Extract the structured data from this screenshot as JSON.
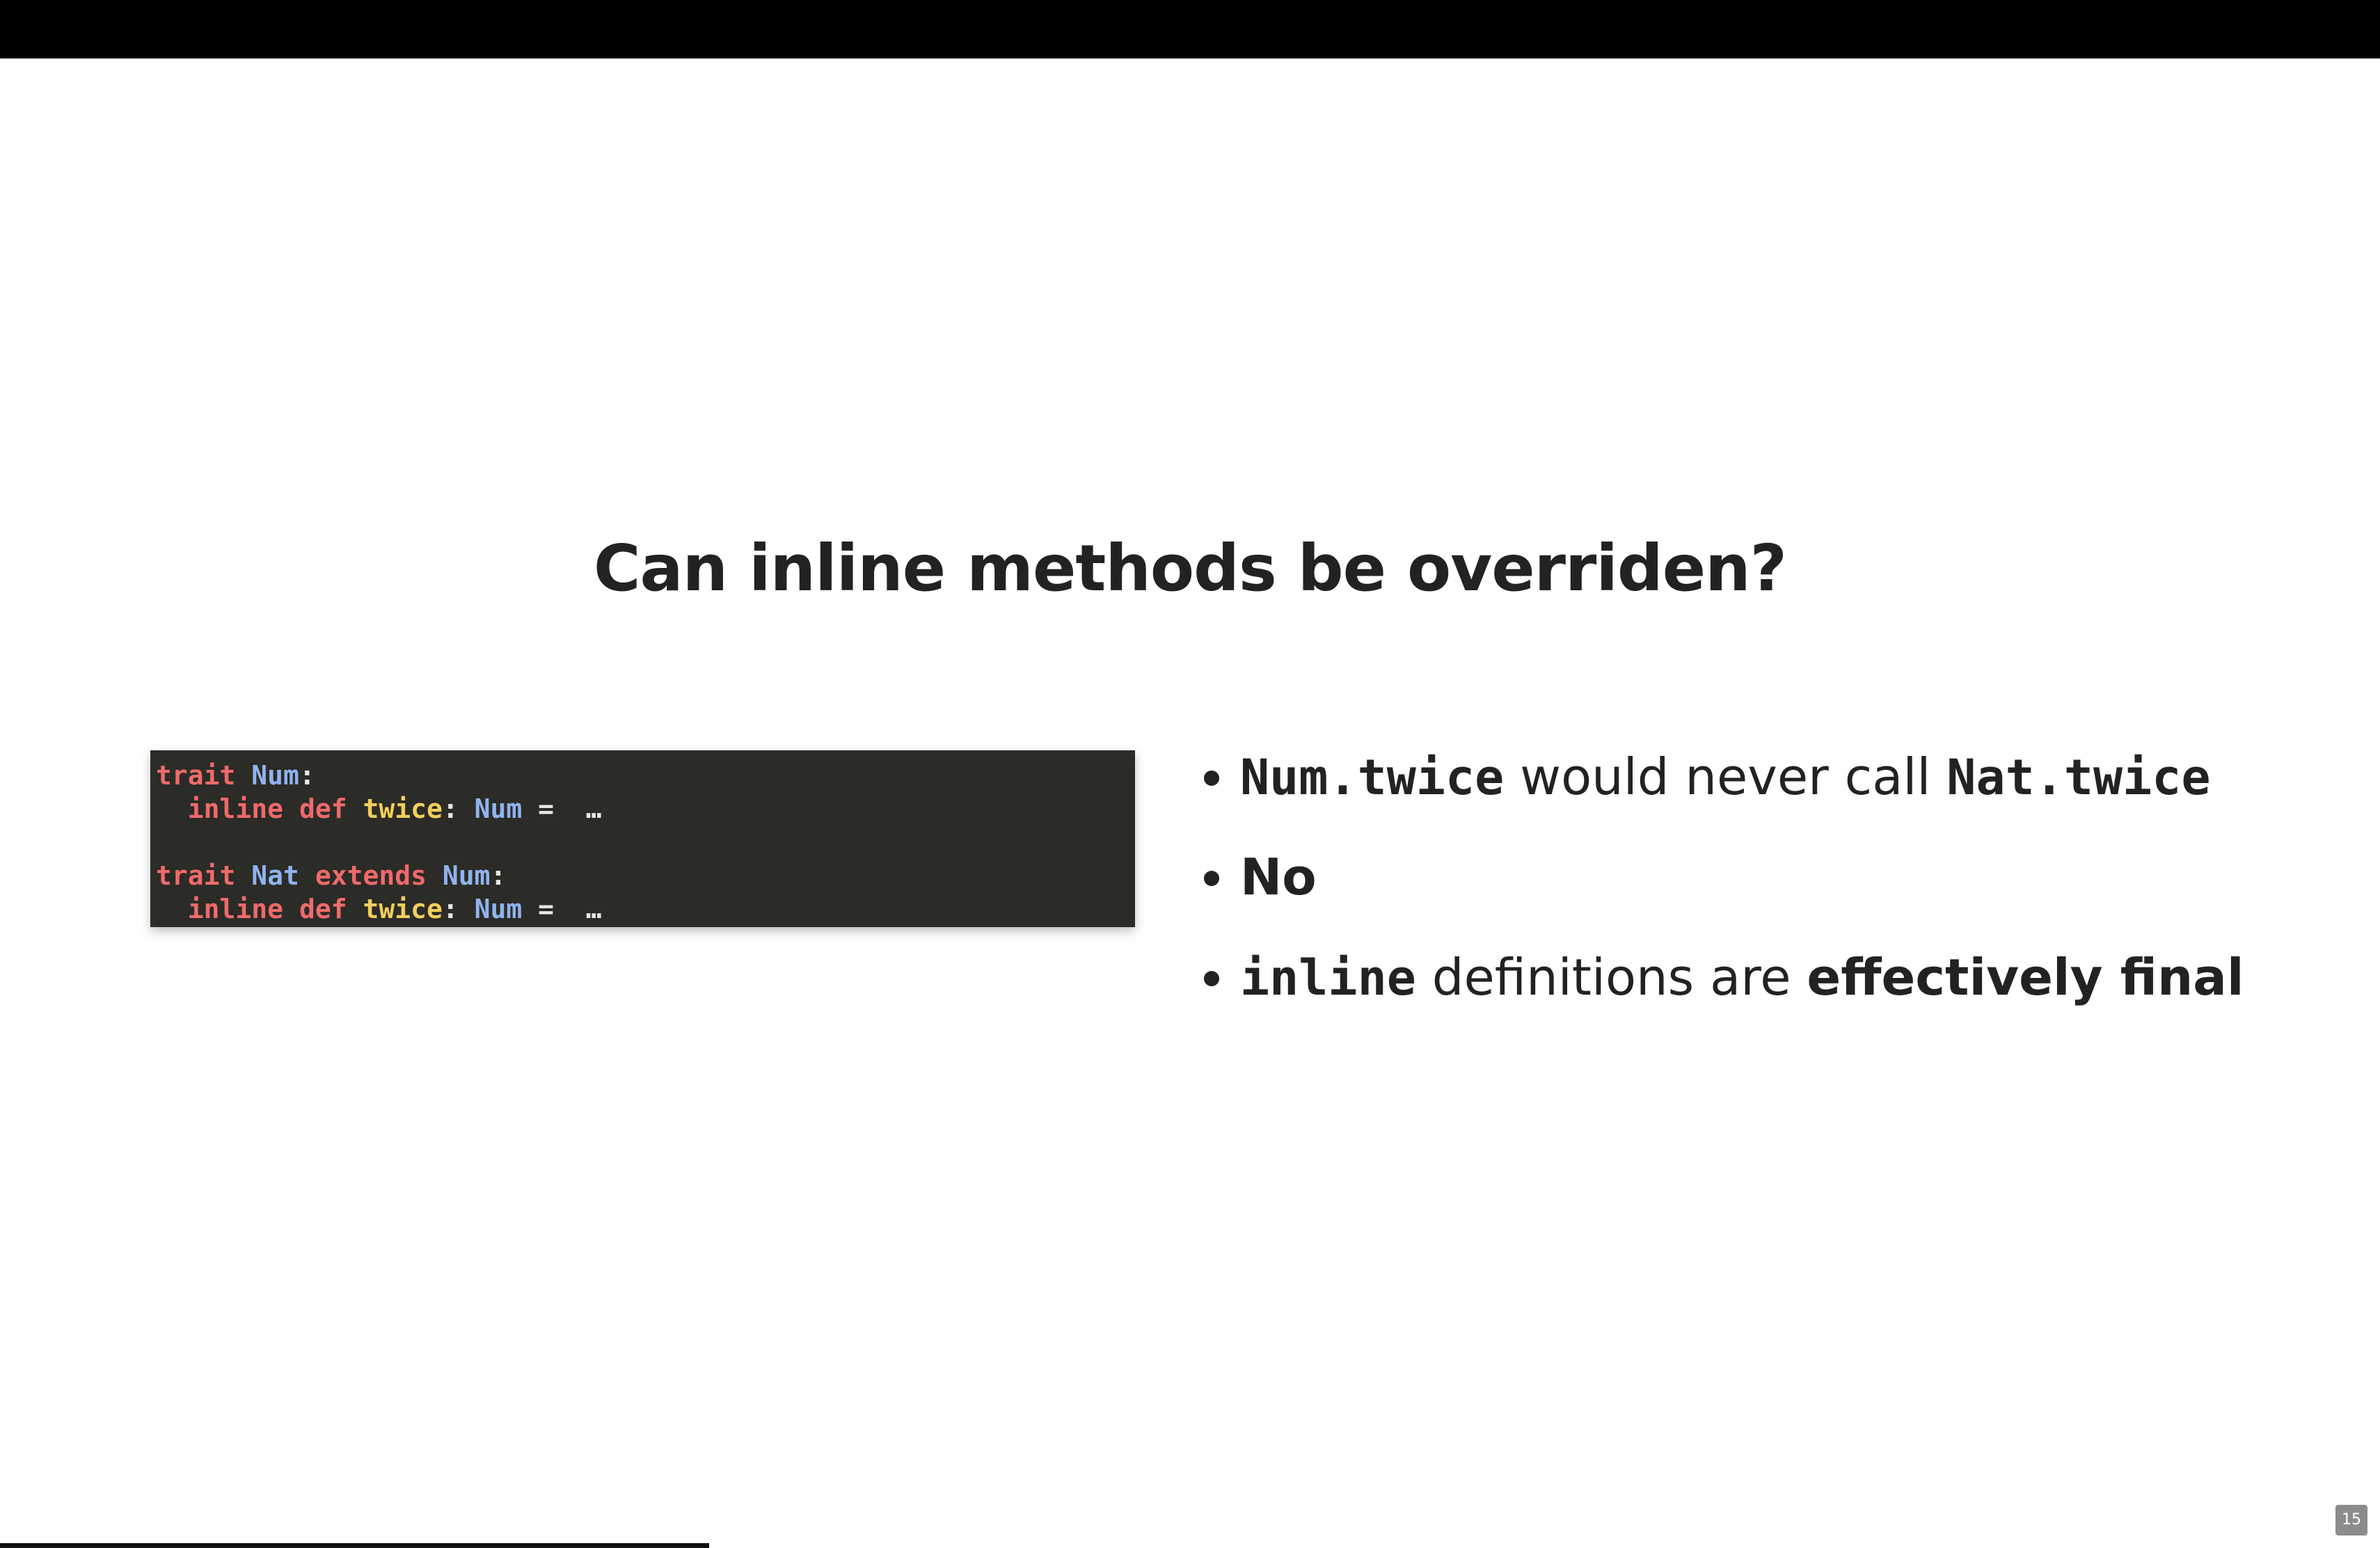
{
  "slide": {
    "title": "Can inline methods be overriden?",
    "page_number": "15",
    "progress_fraction": 0.298
  },
  "code": {
    "line1": {
      "kw": "trait",
      "type": "Num",
      "punct": ":"
    },
    "line2": {
      "indent": "  ",
      "kw1": "inline",
      "kw2": "def",
      "name": "twice",
      "colon": ":",
      "type": "Num",
      "rest": " =  …"
    },
    "line3": {
      "text": ""
    },
    "line4": {
      "kw1": "trait",
      "type1": "Nat",
      "kw2": "extends",
      "type2": "Num",
      "punct": ":"
    },
    "line5": {
      "indent": "  ",
      "kw1": "inline",
      "kw2": "def",
      "name": "twice",
      "colon": ":",
      "type": "Num",
      "rest": " =  …"
    }
  },
  "bullets": [
    {
      "code1": "Num.twice",
      "text1": " would never call ",
      "code2": "Nat.twice"
    },
    {
      "strong": "No"
    },
    {
      "code1": "inline",
      "text1": " definitions are ",
      "strong": "effectively final"
    }
  ],
  "colors": {
    "keyword": "#ef6a6a",
    "type": "#8fb3ee",
    "function": "#f2cf5b",
    "code_background": "#2b2b27"
  }
}
